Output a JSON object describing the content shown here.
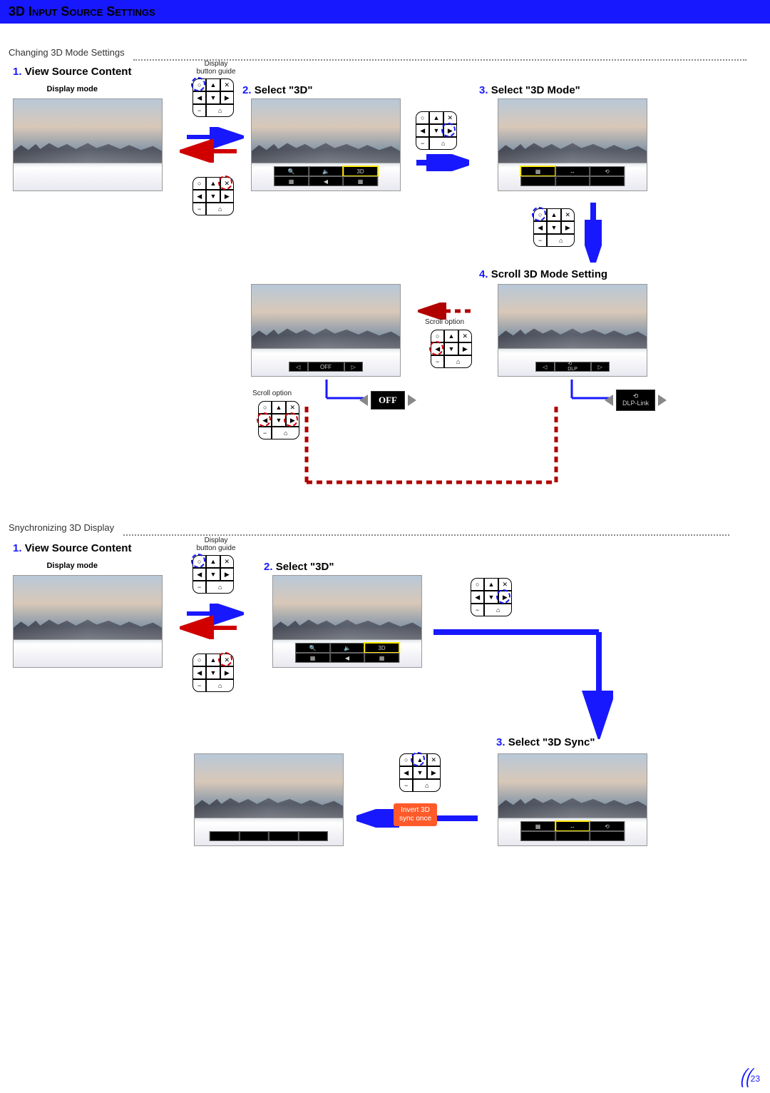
{
  "header": {
    "title": "3D Input Source Settings"
  },
  "section1": {
    "subtitle": "Changing 3D Mode Settings"
  },
  "section2": {
    "subtitle": "Snychronizing 3D Display"
  },
  "steps": {
    "s1_num": "1.",
    "s1_title": "View Source Content",
    "s1_sub": "Display mode",
    "s2_num": "2.",
    "s2_title": "Select \"3D\"",
    "s3_num": "3.",
    "s3_title": "Select \"3D Mode\"",
    "s4_num": "4.",
    "s4_title": "Scroll 3D Mode Setting",
    "sync3_num": "3.",
    "sync3_title": " Select \"3D Sync\""
  },
  "labels": {
    "display_button_guide_l1": "Display",
    "display_button_guide_l2": "button guide",
    "scroll_option": "Scroll option",
    "off": "OFF",
    "dlp_link_l1": "⟲",
    "dlp_link_l2": "DLP-Link",
    "invert_l1": "Invert 3D",
    "invert_l2": "sync once"
  },
  "osd": {
    "zoom": "🔍",
    "vol": "🔈",
    "threeD": "3D",
    "icon1": "▦",
    "icon2": "◀",
    "icon3": "▦"
  },
  "keypad": {
    "circle": "○",
    "up": "▲",
    "x": "✕",
    "left": "◀",
    "down": "▼",
    "right": "▶",
    "minus": "−",
    "home": "⌂"
  },
  "page": {
    "number": "23"
  }
}
